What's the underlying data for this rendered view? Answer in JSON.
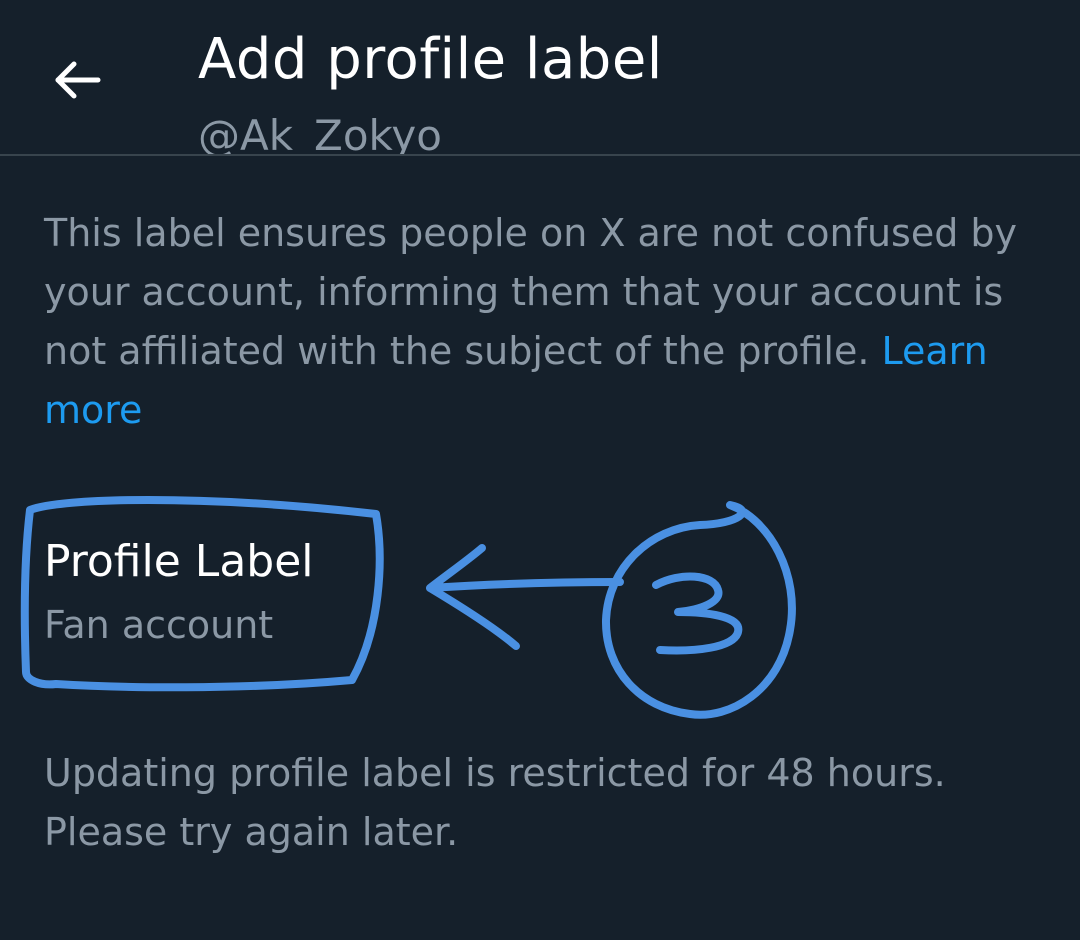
{
  "header": {
    "back_icon": "arrow-left-icon",
    "title": "Add profile label",
    "handle": "@Ak_Zokyo"
  },
  "description": {
    "text": "This label ensures people on X are not confused by your account, informing them that your account is not affiliated with the subject of the profile. ",
    "link_text": "Learn more"
  },
  "profile_label": {
    "heading": "Profile Label",
    "value": "Fan account"
  },
  "restriction_notice": "Updating profile label is restricted for 48 hours. Please try again later.",
  "annotation": {
    "number": "3",
    "color": "#4a90e2"
  },
  "colors": {
    "background": "#15202b",
    "primary_text": "#ffffff",
    "secondary_text": "#8b98a5",
    "link": "#1d9bf0",
    "divider": "#38444d"
  }
}
